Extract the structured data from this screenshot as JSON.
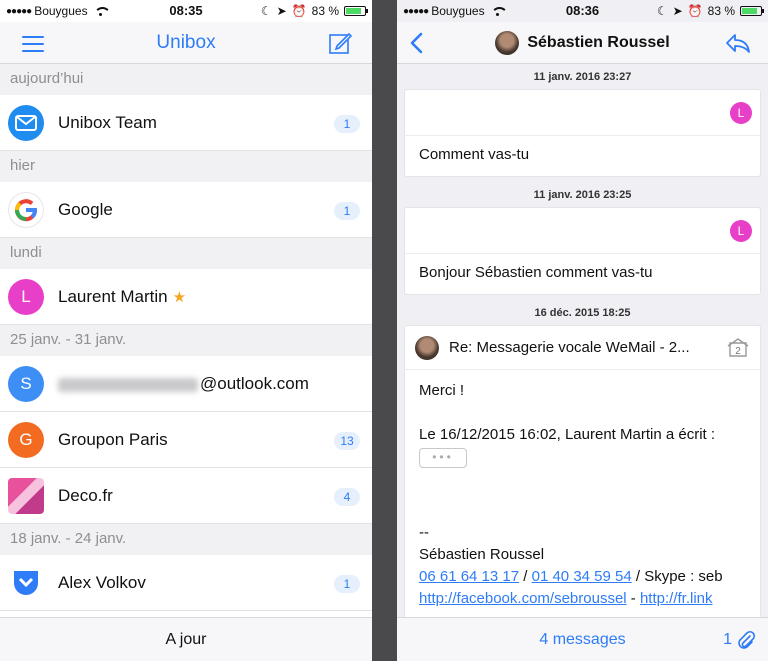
{
  "status_left": {
    "carrier": "Bouygues",
    "time": "08:35",
    "battery": "83 %",
    "battery_level": 0.83
  },
  "status_right": {
    "carrier": "Bouygues",
    "time": "08:36",
    "battery": "83 %",
    "battery_level": 0.83
  },
  "inbox": {
    "title": "Unibox",
    "sections": [
      {
        "label": "aujourd’hui",
        "rows": [
          {
            "name": "Unibox Team",
            "badge": "1",
            "avatar": "unibox-logo"
          }
        ]
      },
      {
        "label": "hier",
        "rows": [
          {
            "name": "Google",
            "badge": "1",
            "avatar": "google-logo"
          }
        ]
      },
      {
        "label": "lundi",
        "rows": [
          {
            "name": "Laurent Martin",
            "initial": "L",
            "starred": true,
            "avatar_color": "#e83fc9"
          }
        ]
      },
      {
        "label": "25 janv. - 31 janv.",
        "rows": [
          {
            "name_suffix": "@outlook.com",
            "initial": "S",
            "avatar_color": "#3d8ff5"
          },
          {
            "name": "Groupon Paris",
            "initial": "G",
            "badge": "13",
            "avatar_color": "#f26b21"
          },
          {
            "name": "Deco.fr",
            "badge": "4",
            "avatar": "deco-logo"
          }
        ]
      },
      {
        "label": "18 janv. - 24 janv.",
        "rows": [
          {
            "name": "Alex Volkov",
            "badge": "1",
            "avatar": "shield-logo"
          }
        ]
      }
    ],
    "footer": "A jour"
  },
  "conversation": {
    "contact": "Sébastien Roussel",
    "messages": [
      {
        "date": "11 janv. 2016 23:27",
        "initial": "L",
        "text": "Comment vas-tu"
      },
      {
        "date": "11 janv. 2016 23:25",
        "initial": "L",
        "text": "Bonjour Sébastien comment vas-tu"
      },
      {
        "date": "16 déc. 2015 18:25",
        "subject": "Re: Messagerie vocale WeMail - 2...",
        "thread_count": "2",
        "line1": "Merci !",
        "line2": "Le 16/12/2015 16:02, Laurent Martin a écrit :",
        "more": "•••",
        "sig_sep": "--",
        "sig_name": "Sébastien Roussel",
        "phone1": "06 61 64 13 17",
        "sep1": " / ",
        "phone2": "01 40 34 59 54",
        "skype": " / Skype : seb",
        "link1": "http://facebook.com/sebroussel",
        "sep2": " - ",
        "link2": "http://fr.link"
      }
    ],
    "footer_count": "4 messages",
    "attachments": "1"
  },
  "colors": {
    "accent": "#2e7cf6",
    "star": "#f5a623"
  }
}
